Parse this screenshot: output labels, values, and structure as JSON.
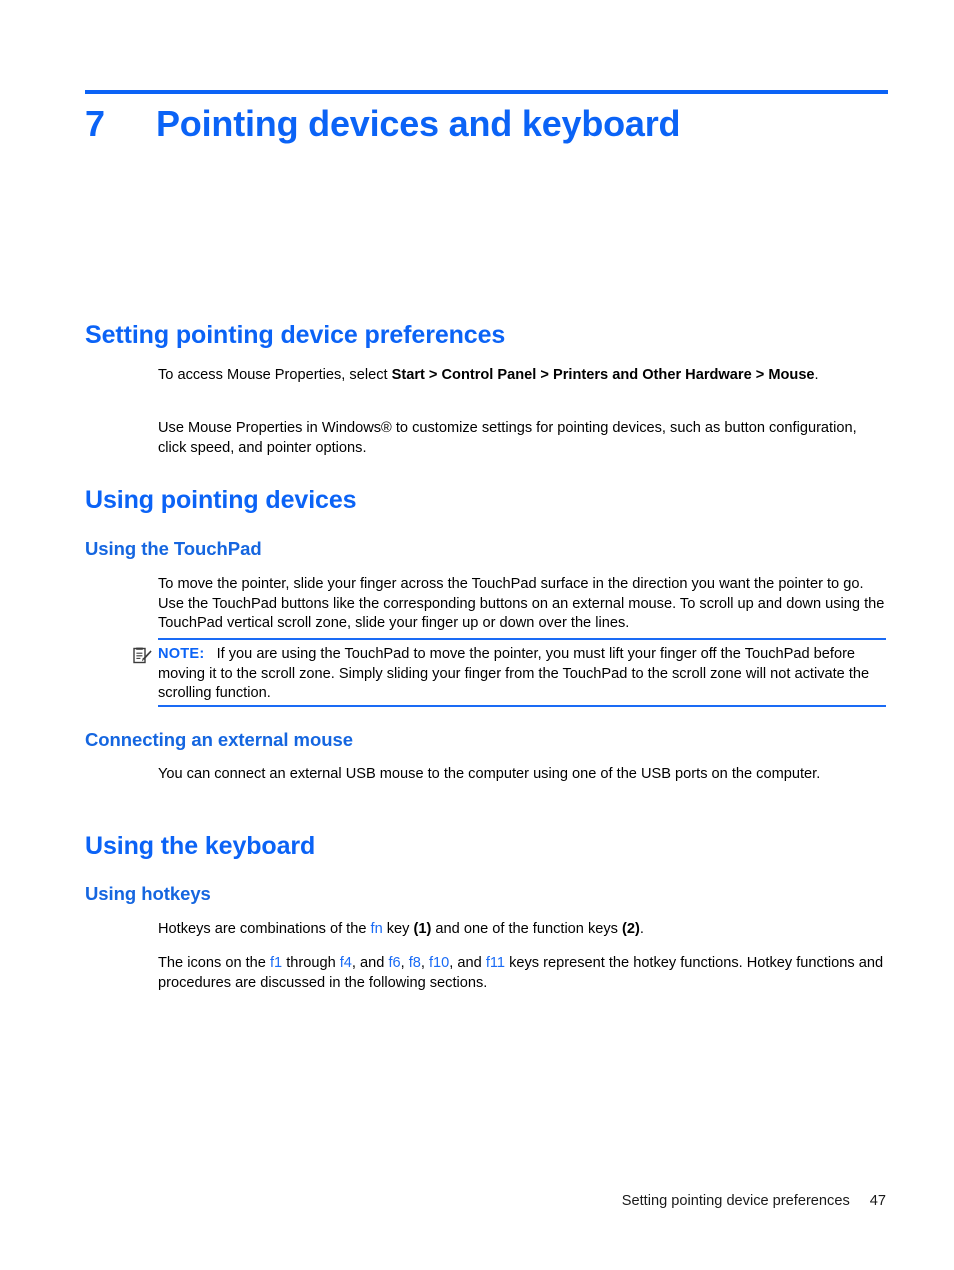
{
  "chapter": {
    "number": "7",
    "title": "Pointing devices and keyboard"
  },
  "sections": {
    "setting_prefs": {
      "heading": "Setting pointing device preferences",
      "p1_pre": "To access Mouse Properties, select ",
      "p1_bold1": "Start > Control Panel > Printers and Other Hardware >",
      "p1_mid": " ",
      "p1_bold2": "Mouse",
      "p1_post": ".",
      "p2": "Use Mouse Properties in Windows® to customize settings for pointing devices, such as button configuration, click speed, and pointer options."
    },
    "using_pointing_devices": {
      "heading": "Using pointing devices"
    },
    "using_touchpad": {
      "heading": "Using the TouchPad",
      "p1": "To move the pointer, slide your finger across the TouchPad surface in the direction you want the pointer to go. Use the TouchPad buttons like the corresponding buttons on an external mouse. To scroll up and down using the TouchPad vertical scroll zone, slide your finger up or down over the lines."
    },
    "note": {
      "icon": "note-pencil-icon",
      "label": "NOTE:",
      "text": "If you are using the TouchPad to move the pointer, you must lift your finger off the TouchPad before moving it to the scroll zone. Simply sliding your finger from the TouchPad to the scroll zone will not activate the scrolling function."
    },
    "connecting_mouse": {
      "heading": "Connecting an external mouse",
      "p1": "You can connect an external USB mouse to the computer using one of the USB ports on the computer."
    },
    "using_keyboard": {
      "heading": "Using the keyboard"
    },
    "using_hotkeys": {
      "heading": "Using hotkeys",
      "p1_pre": "Hotkeys are combinations of the ",
      "p1_fn": "fn",
      "p1_mid1": " key ",
      "p1_b1": "(1)",
      "p1_mid2": " and one of the function keys ",
      "p1_b2": "(2)",
      "p1_post": ".",
      "p2_pre": "The icons on the ",
      "p2_f1": "f1",
      "p2_s1": " through ",
      "p2_f4": "f4",
      "p2_s2": ", and ",
      "p2_f6": "f6",
      "p2_s3": ", ",
      "p2_f8": "f8",
      "p2_s4": ", ",
      "p2_f10": "f10",
      "p2_s5": ", and ",
      "p2_f11": "f11",
      "p2_post": " keys represent the hotkey functions. Hotkey functions and procedures are discussed in the following sections."
    }
  },
  "footer": {
    "title": "Setting pointing device preferences",
    "page_number": "47"
  },
  "colors": {
    "heading_blue": "#0b63f6",
    "link_blue": "#1a6bf5",
    "subheading_blue": "#1566e0",
    "text_black": "#000000"
  }
}
